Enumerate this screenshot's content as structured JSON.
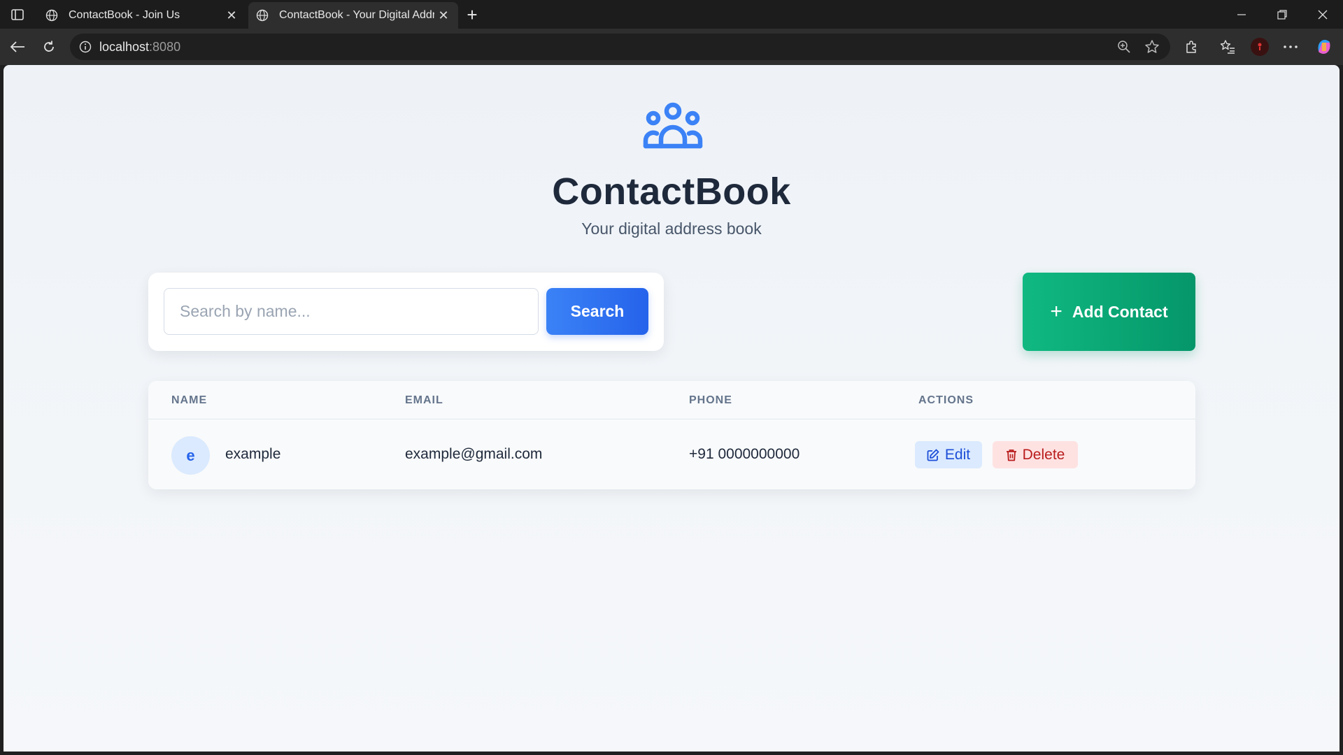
{
  "browser": {
    "tabs": [
      {
        "title": "ContactBook - Join Us",
        "active": false,
        "icon": "globe-icon"
      },
      {
        "title": "ContactBook - Your Digital Addre",
        "active": true,
        "icon": "globe-icon"
      }
    ],
    "url_host": "localhost",
    "url_port": ":8080"
  },
  "app": {
    "logo_icon": "users-group-icon",
    "title": "ContactBook",
    "subtitle": "Your digital address book"
  },
  "search": {
    "placeholder": "Search by name...",
    "value": "",
    "button_label": "Search"
  },
  "add_contact": {
    "label": "Add Contact",
    "icon": "plus-icon"
  },
  "table": {
    "headers": [
      "NAME",
      "EMAIL",
      "PHONE",
      "ACTIONS"
    ],
    "rows": [
      {
        "avatar_letter": "e",
        "name": "example",
        "email": "example@gmail.com",
        "phone": "+91 0000000000",
        "edit_label": "Edit",
        "delete_label": "Delete"
      }
    ]
  },
  "colors": {
    "primary": "#2563eb",
    "success": "#059669",
    "danger": "#b91c1c",
    "title": "#1e293b"
  }
}
